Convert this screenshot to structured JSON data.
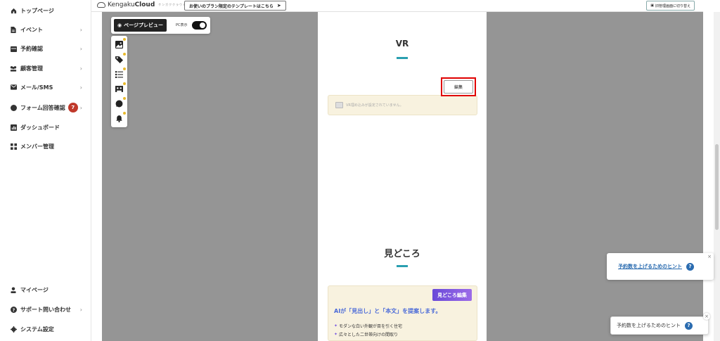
{
  "sidebar": {
    "items": [
      {
        "label": "トップページ",
        "icon": "home-icon",
        "chevron": false
      },
      {
        "label": "イベント",
        "icon": "document-icon",
        "chevron": true
      },
      {
        "label": "予約確認",
        "icon": "calendar-icon",
        "chevron": true
      },
      {
        "label": "顧客管理",
        "icon": "users-icon",
        "chevron": true
      },
      {
        "label": "メール/SMS",
        "icon": "mail-icon",
        "chevron": true
      },
      {
        "label": "フォーム回答確認",
        "icon": "chat-icon",
        "chevron": true,
        "badge": "7"
      },
      {
        "label": "ダッシュボード",
        "icon": "chart-icon",
        "chevron": false
      },
      {
        "label": "メンバー管理",
        "icon": "grid-icon",
        "chevron": false
      }
    ],
    "bottom_items": [
      {
        "label": "マイページ",
        "icon": "person-icon",
        "chevron": false
      },
      {
        "label": "サポート問い合わせ",
        "icon": "help-icon",
        "chevron": true
      },
      {
        "label": "システム設定",
        "icon": "gear-icon",
        "chevron": false
      }
    ],
    "chevron_glyph": "›"
  },
  "topbar": {
    "logo_text_light": "Kengaku",
    "logo_text_bold": "Cloud",
    "logo_sub": "ケンガククラウド",
    "template_button": "お使いのプラン限定のテンプレートはこちら",
    "old_admin_button": "旧管理画面に切り替え"
  },
  "toolbar": {
    "preview_label": "ページプレビュー",
    "pc_label": "PC表示",
    "pc_toggle_on": true
  },
  "rail_icons": [
    "image-edit-icon",
    "tag-icon",
    "checklist-icon",
    "floorplan-icon",
    "chat-bubble-icon",
    "bell-icon"
  ],
  "content": {
    "vr_title": "VR",
    "edit_label": "編集",
    "vr_empty_text": "VR埋め込みが設定されていません。",
    "highlights_title": "見どころ",
    "ai_edit_label": "見どころ編集",
    "ai_headline": "AIが「見出し」と「本文」を提案します。",
    "ai_examples": [
      "モダンな白い外観が目を引く住宅",
      "広々とした二世帯向けの間取り"
    ]
  },
  "hints": {
    "hint_link": "予約数を上げるためのヒント",
    "hint_button": "予約数を上げるためのヒント",
    "close_glyph": "×",
    "q_glyph": "?"
  },
  "colors": {
    "accent": "#2a9fb0",
    "highlight_border": "#e00000",
    "badge": "#c0392b",
    "canvas": "#959595",
    "panel_bg": "#f8f2df",
    "link_blue": "#2b6cb0"
  }
}
